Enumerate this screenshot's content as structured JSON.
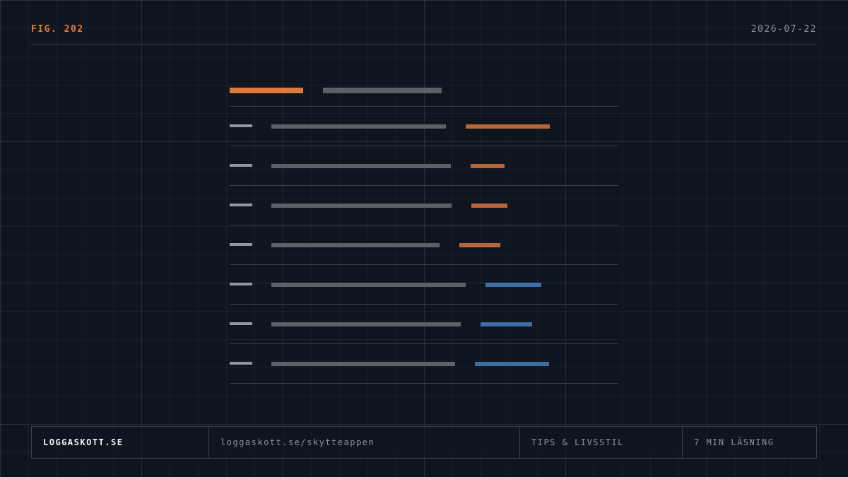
{
  "header": {
    "figure_label": "FIG. 202",
    "date": "2026-07-22"
  },
  "colors": {
    "accent_orange": "#e07a3c",
    "muted_orange": "#b8653a",
    "accent_blue": "#3d6ea6",
    "placeholder_gray": "#5b6168",
    "label_gray": "#8f99a3",
    "rule_gray": "#3a424c"
  },
  "skeleton": {
    "header_row": {
      "accent": "orange"
    },
    "rows": [
      {
        "accent": "orange"
      },
      {
        "accent": "orange"
      },
      {
        "accent": "orange"
      },
      {
        "accent": "orange"
      },
      {
        "accent": "blue"
      },
      {
        "accent": "blue"
      },
      {
        "accent": "blue"
      }
    ]
  },
  "footer": {
    "brand": "LOGGASKOTT.SE",
    "url": "loggaskott.se/skytteappen",
    "category": "TIPS & LIVSSTIL",
    "read_time": "7 MIN LÄSNING"
  }
}
